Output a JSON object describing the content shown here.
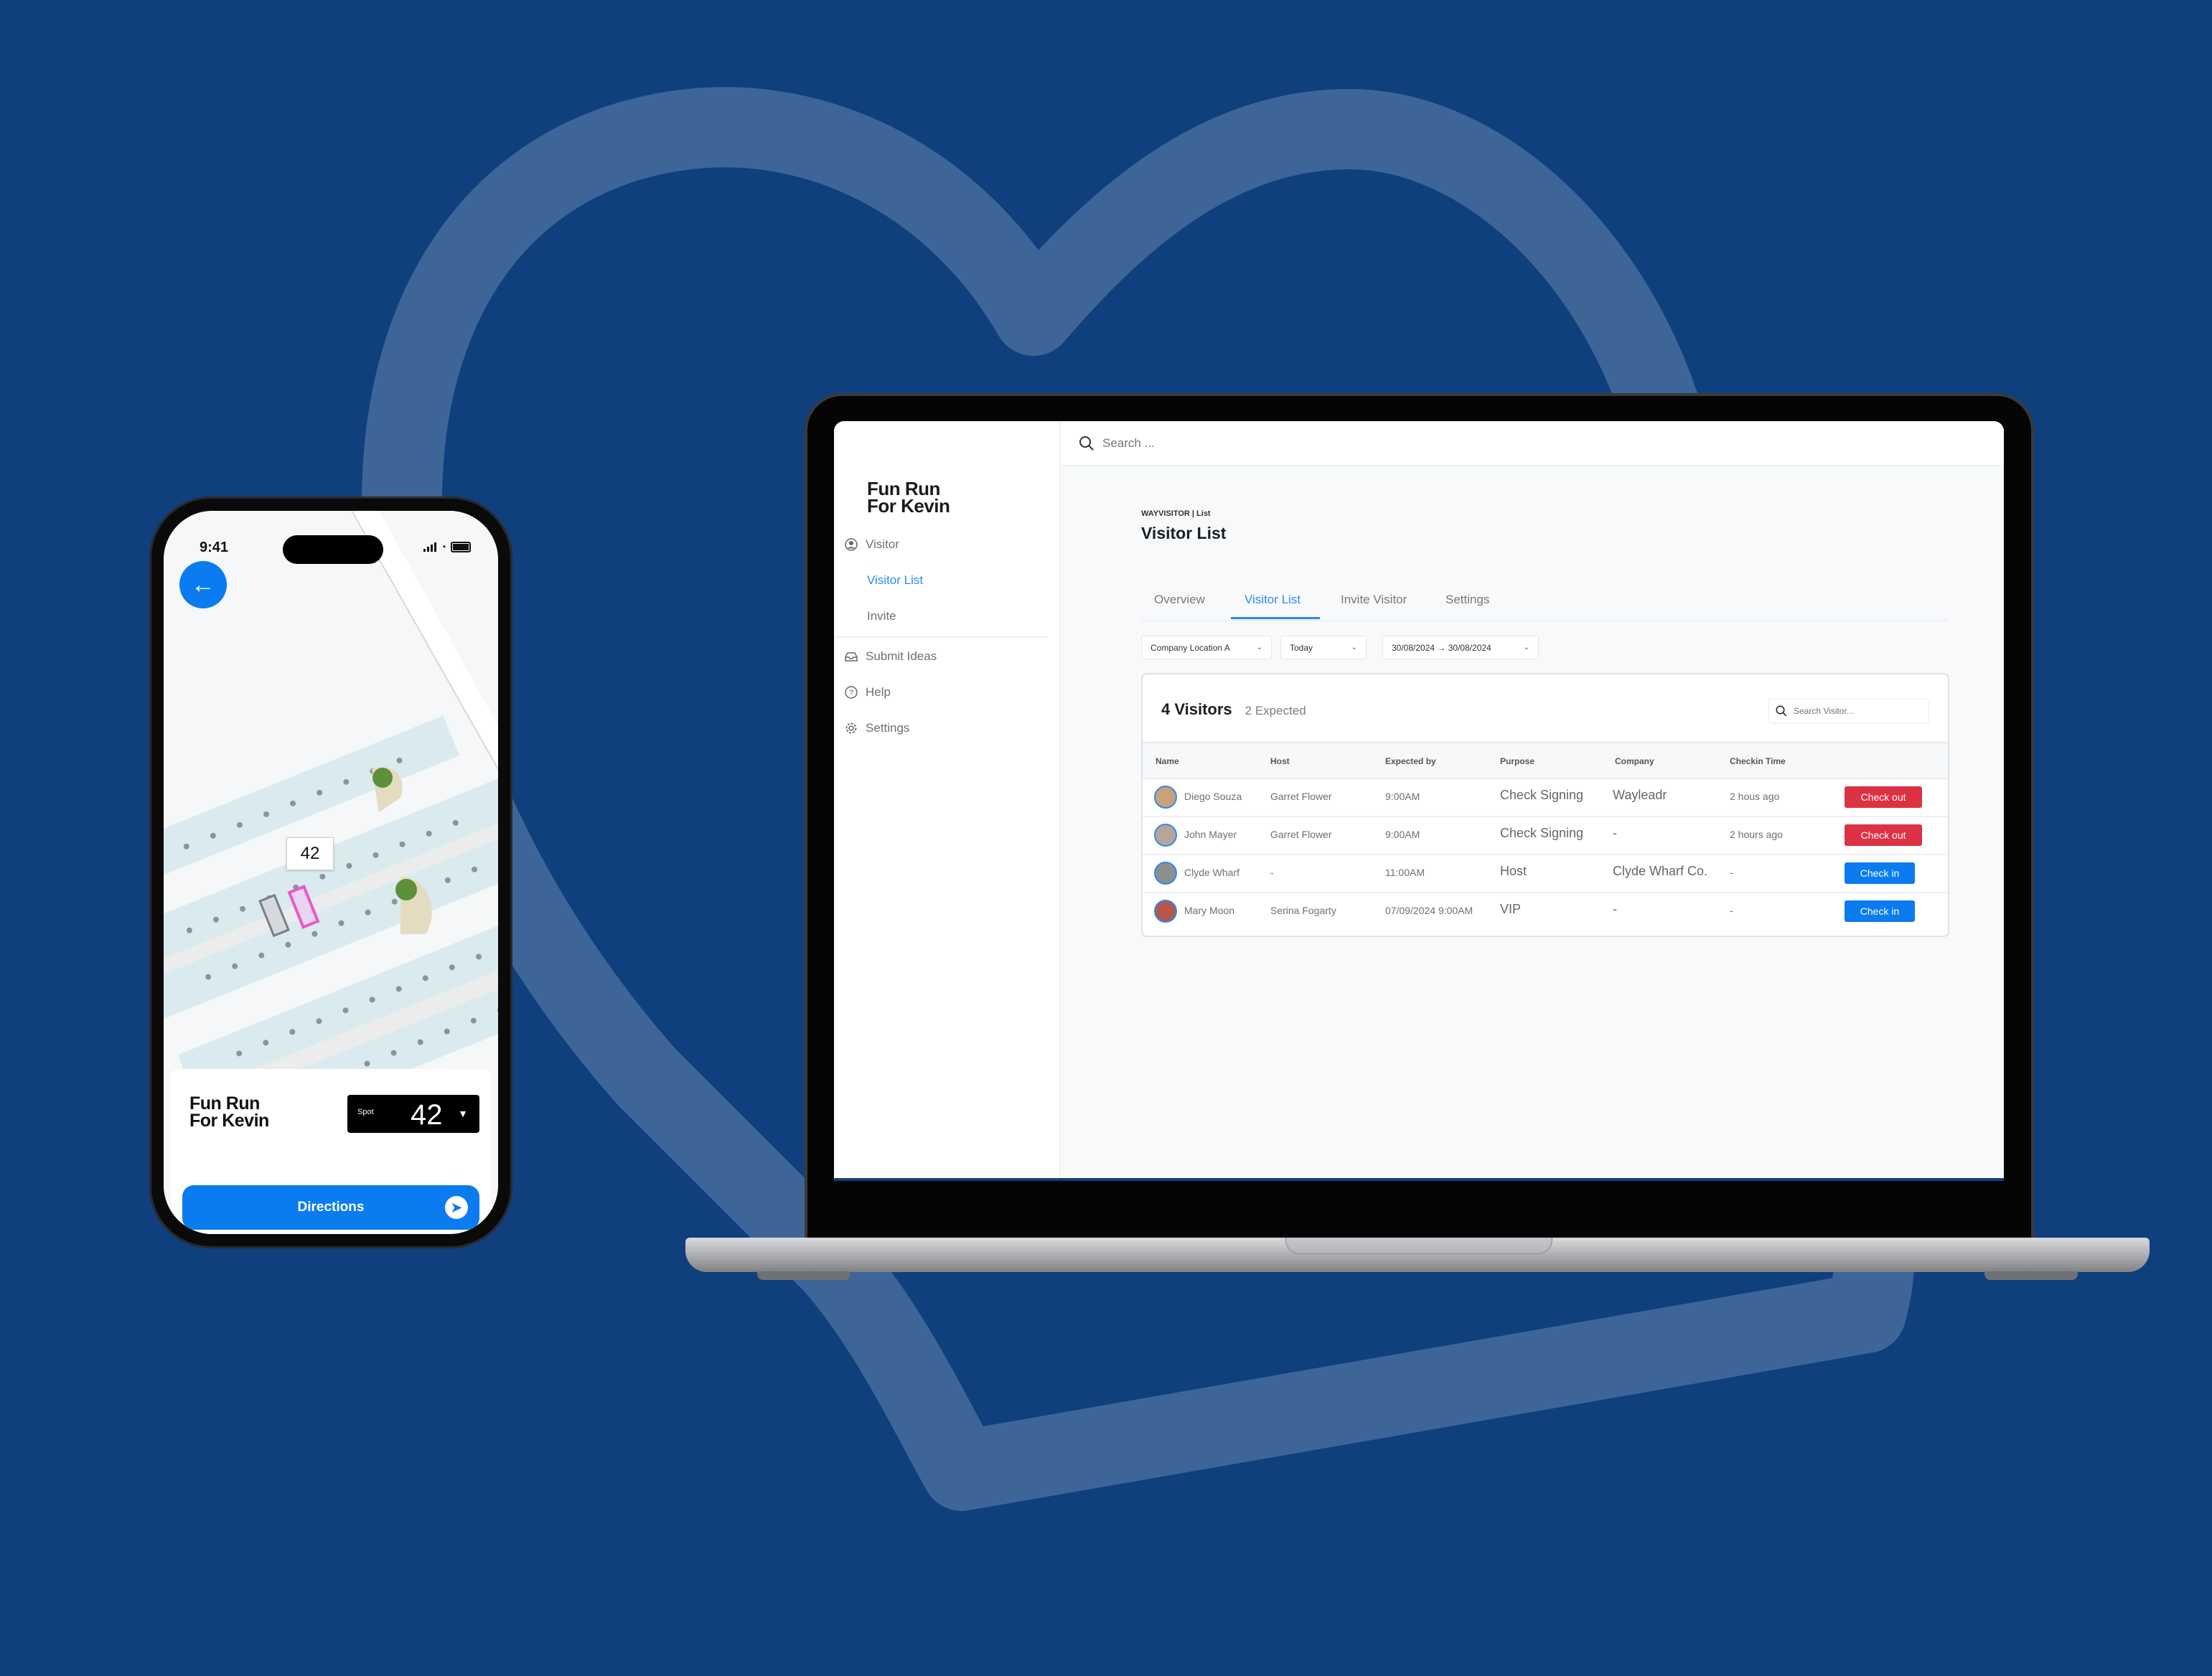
{
  "colors": {
    "background": "#0f3f7d",
    "heart_stroke": "#3d6597",
    "accent_blue": "#0b7bf0",
    "link_blue": "#2c8af1",
    "danger_red": "#dc3243",
    "spot_highlight": "#e85ac8"
  },
  "phone": {
    "status": {
      "time": "9:41"
    },
    "icons": {
      "back": "arrow-left-icon",
      "signal": "signal-icon",
      "wifi": "wifi-icon",
      "battery": "battery-icon",
      "directions": "navigation-arrow-icon",
      "caret": "caret-down-icon"
    },
    "map": {
      "selected_spot_label": "42"
    },
    "sheet": {
      "title_line1": "Fun Run",
      "title_line2": "For Kevin",
      "spot_label": "Spot",
      "spot_number": "42",
      "spot_caret": "▼",
      "directions_label": "Directions"
    }
  },
  "laptop": {
    "sidebar": {
      "brand_line1": "Fun Run",
      "brand_line2": "For Kevin",
      "items": [
        {
          "label": "Visitor",
          "icon": "user-circle-icon"
        },
        {
          "label": "Visitor List",
          "active": true
        },
        {
          "label": "Invite"
        },
        {
          "label": "Submit Ideas",
          "icon": "inbox-icon"
        },
        {
          "label": "Help",
          "icon": "help-circle-icon"
        },
        {
          "label": "Settings",
          "icon": "gear-icon"
        }
      ]
    },
    "topbar": {
      "search_placeholder": "Search ..."
    },
    "page": {
      "breadcrumb": "WAYVISITOR | List",
      "title": "Visitor List",
      "tabs": [
        {
          "label": "Overview"
        },
        {
          "label": "Visitor List",
          "active": true
        },
        {
          "label": "Invite Visitor"
        },
        {
          "label": "Settings"
        }
      ],
      "filters": {
        "location": "Company Location A",
        "period": "Today",
        "date_range": "30/08/2024 → 30/08/2024"
      },
      "card": {
        "count": "4 Visitors",
        "expected": "2 Expected",
        "search_placeholder": "Search Visitor...",
        "columns": [
          "Name",
          "Host",
          "Expected by",
          "Purpose",
          "Company",
          "Checkin Time"
        ],
        "rows": [
          {
            "name": "Diego Souza",
            "host": "Garret Flower",
            "expected_by": "9:00AM",
            "purpose": "Check Signing",
            "company": "Wayleadr",
            "checkin_time": "2 hous ago",
            "action": "Check out",
            "action_type": "out",
            "avatar_color": "#c9a27a"
          },
          {
            "name": "John Mayer",
            "host": "Garret Flower",
            "expected_by": "9:00AM",
            "purpose": "Check Signing",
            "company": "-",
            "checkin_time": "2 hours ago",
            "action": "Check out",
            "action_type": "out",
            "avatar_color": "#b8a597"
          },
          {
            "name": "Clyde Wharf",
            "host": "-",
            "expected_by": "11:00AM",
            "purpose": "Host",
            "company": "Clyde Wharf Co.",
            "checkin_time": "-",
            "action": "Check in",
            "action_type": "in",
            "avatar_color": "#8e8e8e"
          },
          {
            "name": "Mary Moon",
            "host": "Serina Fogarty",
            "expected_by": "07/09/2024 9:00AM",
            "purpose": "VIP",
            "company": "-",
            "checkin_time": "-",
            "action": "Check in",
            "action_type": "in",
            "avatar_color": "#b5584b"
          }
        ]
      }
    }
  }
}
